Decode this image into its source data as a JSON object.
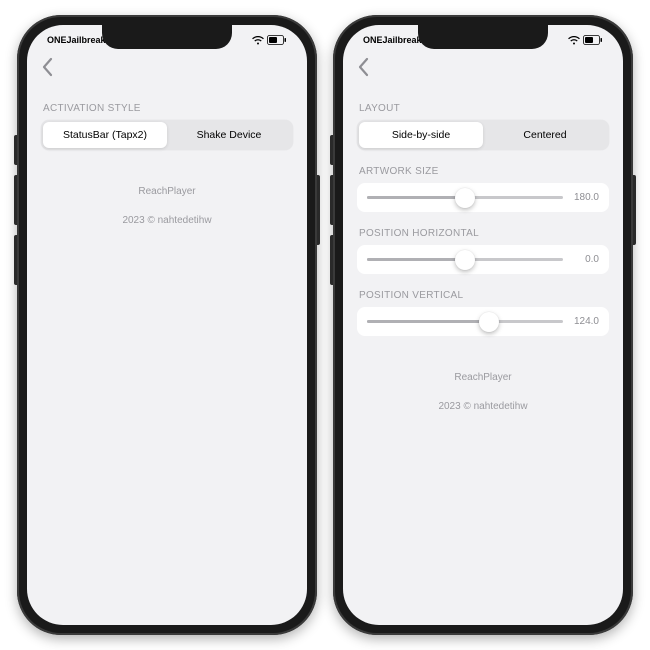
{
  "statusBar": {
    "carrier": "ONEJailbreak",
    "battery": "58"
  },
  "left": {
    "sections": {
      "activation": {
        "label": "ACTIVATION STYLE",
        "options": [
          "StatusBar (Tapx2)",
          "Shake Device"
        ],
        "selected": 0
      }
    },
    "footer": {
      "app": "ReachPlayer",
      "copyright": "2023 © nahtedetihw"
    }
  },
  "right": {
    "sections": {
      "layout": {
        "label": "LAYOUT",
        "options": [
          "Side-by-side",
          "Centered"
        ],
        "selected": 0
      },
      "artwork": {
        "label": "ARTWORK SIZE",
        "value": "180.0",
        "percent": 50
      },
      "posH": {
        "label": "POSITION HORIZONTAL",
        "value": "0.0",
        "percent": 50
      },
      "posV": {
        "label": "POSITION VERTICAL",
        "value": "124.0",
        "percent": 62
      }
    },
    "footer": {
      "app": "ReachPlayer",
      "copyright": "2023 © nahtedetihw"
    }
  }
}
